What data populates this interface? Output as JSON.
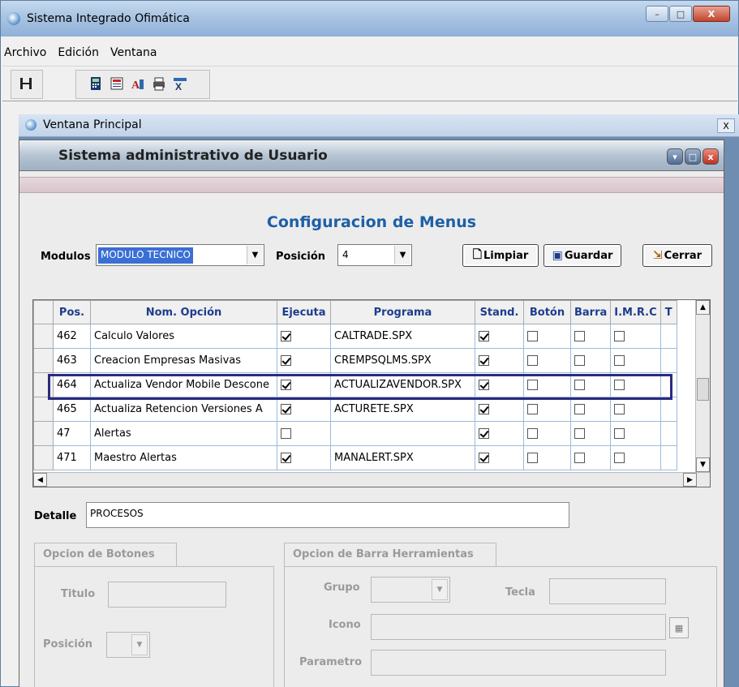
{
  "app": {
    "title": "Sistema Integrado Ofimática",
    "minimize": "–",
    "maximize": "□",
    "close": "X"
  },
  "menu": [
    "Archivo",
    "Edición",
    "Ventana"
  ],
  "toolbar": {
    "icons": [
      "exit-icon",
      "calculator-icon",
      "document-icon",
      "font-icon",
      "printer-icon",
      "excel-icon"
    ]
  },
  "mdi": {
    "title": "Ventana Principal",
    "close": "X"
  },
  "admin": {
    "title": "Sistema administrativo de Usuario",
    "btn_restore": "▾",
    "btn_max": "□",
    "btn_close": "x"
  },
  "config": {
    "title": "Configuracion de Menus",
    "modulos_label": "Modulos",
    "modulos_value": "MODULO TECNICO",
    "posicion_label": "Posición",
    "posicion_value": "4",
    "btn_limpiar": "Limpiar",
    "btn_guardar": "Guardar",
    "btn_cerrar": "Cerrar"
  },
  "grid": {
    "columns": [
      "Pos.",
      "Nom. Opción",
      "Ejecuta",
      "Programa",
      "Stand.",
      "Botón",
      "Barra",
      "I.M.R.C",
      "T"
    ],
    "rows": [
      {
        "pos": "462",
        "nombre": "Calculo Valores",
        "ejecuta": true,
        "programa": "CALTRADE.SPX",
        "stand": true
      },
      {
        "pos": "463",
        "nombre": "Creacion Empresas Masivas",
        "ejecuta": true,
        "programa": "CREMPSQLMS.SPX",
        "stand": true
      },
      {
        "pos": "464",
        "nombre": "Actualiza Vendor Mobile Descone",
        "ejecuta": true,
        "programa": "ACTUALIZAVENDOR.SPX",
        "stand": true
      },
      {
        "pos": "465",
        "nombre": "Actualiza Retencion Versiones A",
        "ejecuta": true,
        "programa": "ACTURETE.SPX",
        "stand": true
      },
      {
        "pos": "47",
        "nombre": "Alertas",
        "ejecuta": false,
        "programa": "",
        "stand": true
      },
      {
        "pos": "471",
        "nombre": "Maestro Alertas",
        "ejecuta": true,
        "programa": "MANALERT.SPX",
        "stand": true
      }
    ]
  },
  "detalle": {
    "label": "Detalle",
    "value": "PROCESOS"
  },
  "botones": {
    "tab": "Opcion de Botones",
    "titulo_label": "Titulo",
    "posicion_label": "Posición"
  },
  "barra": {
    "tab": "Opcion de Barra Herramientas",
    "grupo_label": "Grupo",
    "tecla_label": "Tecla",
    "icono_label": "Icono",
    "parametro_label": "Parametro"
  }
}
